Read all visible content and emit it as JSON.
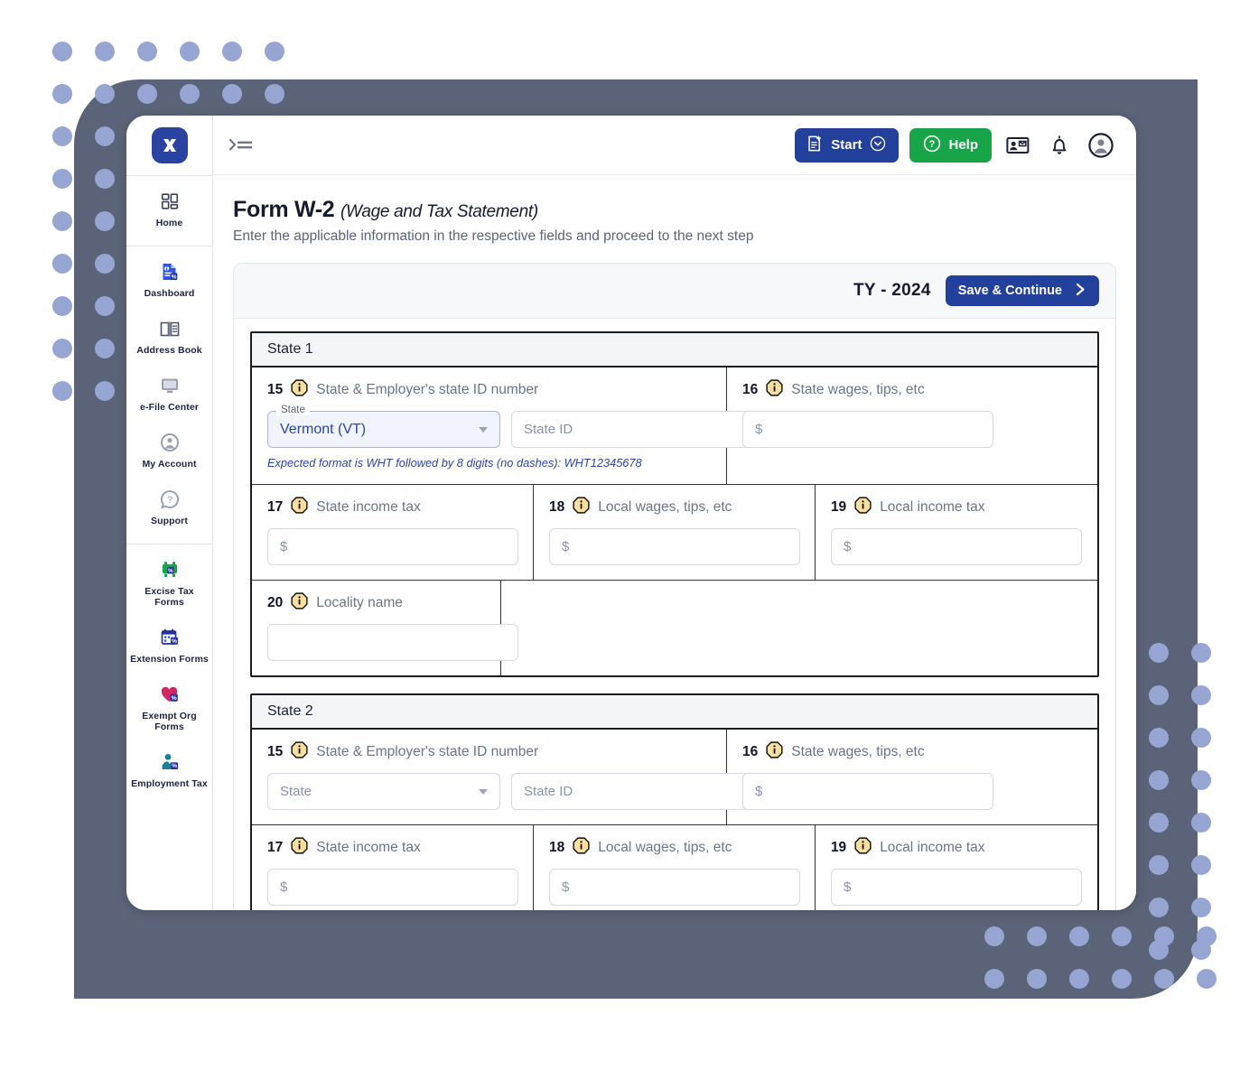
{
  "app": {
    "logo_icon": "x-logo-icon",
    "collapse_icon": "collapse-menu-icon"
  },
  "sidebar": {
    "groups": [
      {
        "items": [
          {
            "label": "Home",
            "icon": "grid-dashboard-icon"
          }
        ]
      },
      {
        "items": [
          {
            "label": "Dashboard",
            "icon": "document-tax-icon"
          },
          {
            "label": "Address Book",
            "icon": "open-book-icon"
          },
          {
            "label": "e-File Center",
            "icon": "monitor-icon"
          },
          {
            "label": "My Account",
            "icon": "user-circle-icon"
          },
          {
            "label": "Support",
            "icon": "question-speech-icon"
          }
        ]
      },
      {
        "items": [
          {
            "label": "Excise Tax Forms",
            "icon": "truck-tax-icon"
          },
          {
            "label": "Extension Forms",
            "icon": "calendar-tax-icon"
          },
          {
            "label": "Exempt Org Forms",
            "icon": "heart-tax-icon"
          },
          {
            "label": "Employment Tax",
            "icon": "person-tax-icon"
          }
        ]
      }
    ]
  },
  "toolbar": {
    "start_label": "Start",
    "start_icon": "document-plus-icon",
    "start_caret_icon": "chevron-down-circle-icon",
    "help_label": "Help",
    "help_icon": "question-circle-icon",
    "contact_card_icon": "contact-card-icon",
    "bell_icon": "notification-bell-icon",
    "account_icon": "account-avatar-icon"
  },
  "page": {
    "title": "Form W-2",
    "title_sub": "(Wage and Tax Statement)",
    "description": "Enter the applicable information in the respective fields and proceed to the next step"
  },
  "card": {
    "tax_year": "TY - 2024",
    "save_label": "Save & Continue",
    "save_icon": "chevron-right-icon"
  },
  "labels": {
    "b15_num": "15",
    "b15_text": "State & Employer's state ID number",
    "b16_num": "16",
    "b16_text": "State wages, tips, etc",
    "b17_num": "17",
    "b17_text": "State income tax",
    "b18_num": "18",
    "b18_text": "Local wages, tips, etc",
    "b19_num": "19",
    "b19_text": "Local income tax",
    "b20_num": "20",
    "b20_text": "Locality name",
    "info_icon": "info-octagon-icon"
  },
  "state1": {
    "heading": "State 1",
    "state_float_label": "State",
    "state_value": "Vermont (VT)",
    "state_id_placeholder": "State ID",
    "state_id_value": "",
    "helper_text": "Expected format is WHT followed by 8 digits (no dashes): WHT12345678",
    "b16_placeholder": "$",
    "b16_value": "",
    "b17_placeholder": "$",
    "b17_value": "",
    "b18_placeholder": "$",
    "b18_value": "",
    "b19_placeholder": "$",
    "b19_value": "",
    "b20_placeholder": "",
    "b20_value": ""
  },
  "state2": {
    "heading": "State 2",
    "state_placeholder": "State",
    "state_value": "",
    "state_id_placeholder": "State ID",
    "state_id_value": "",
    "b16_placeholder": "$",
    "b16_value": "",
    "b17_placeholder": "$",
    "b17_value": "",
    "b18_placeholder": "$",
    "b18_value": "",
    "b19_placeholder": "$",
    "b19_value": ""
  },
  "colors": {
    "frame": "#5b6378",
    "dots": "#97a5d3",
    "primary_blue": "#23409a",
    "green": "#18a54a",
    "info_amber": "#f7dd9a",
    "select_blue": "#2d45a8"
  }
}
